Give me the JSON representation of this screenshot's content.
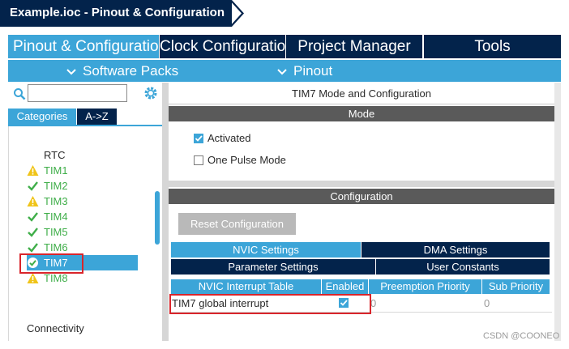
{
  "window": {
    "title": "Example.ioc - Pinout & Configuration"
  },
  "main_tabs": [
    {
      "label": "Pinout & Configuration"
    },
    {
      "label": "Clock Configuration"
    },
    {
      "label": "Project Manager"
    },
    {
      "label": "Tools"
    }
  ],
  "sub_bar": {
    "software_packs": "Software Packs",
    "pinout": "Pinout"
  },
  "left_panel": {
    "search": {
      "value": "",
      "placeholder": ""
    },
    "tabs": {
      "categories": "Categories",
      "az": "A->Z"
    },
    "items": [
      {
        "label": "RTC",
        "status": "none"
      },
      {
        "label": "TIM1",
        "status": "warning"
      },
      {
        "label": "TIM2",
        "status": "ok"
      },
      {
        "label": "TIM3",
        "status": "warning"
      },
      {
        "label": "TIM4",
        "status": "ok"
      },
      {
        "label": "TIM5",
        "status": "ok"
      },
      {
        "label": "TIM6",
        "status": "ok"
      },
      {
        "label": "TIM7",
        "status": "selected"
      },
      {
        "label": "TIM8",
        "status": "warning"
      }
    ],
    "category_footer": "Connectivity"
  },
  "right_panel": {
    "title": "TIM7 Mode and Configuration",
    "mode_header": "Mode",
    "activated": {
      "label": "Activated",
      "checked": true
    },
    "one_pulse": {
      "label": "One Pulse Mode",
      "checked": false
    },
    "config_header": "Configuration",
    "reset_button": "Reset Configuration",
    "tabs": [
      {
        "label": "NVIC Settings",
        "active": true
      },
      {
        "label": "DMA Settings",
        "active": false
      },
      {
        "label": "Parameter Settings",
        "active": false
      },
      {
        "label": "User Constants",
        "active": false
      }
    ],
    "table": {
      "headers": [
        "NVIC Interrupt Table",
        "Enabled",
        "Preemption Priority",
        "Sub Priority"
      ],
      "rows": [
        {
          "name": "TIM7 global interrupt",
          "enabled": true,
          "preemption": "0",
          "sub": "0"
        }
      ]
    }
  },
  "watermark": "CSDN @COONEO",
  "colors": {
    "navy": "#03234b",
    "accent": "#3ca5d8",
    "ok": "#3fae49",
    "warning": "#f0c419",
    "highlight": "#d9252b"
  }
}
